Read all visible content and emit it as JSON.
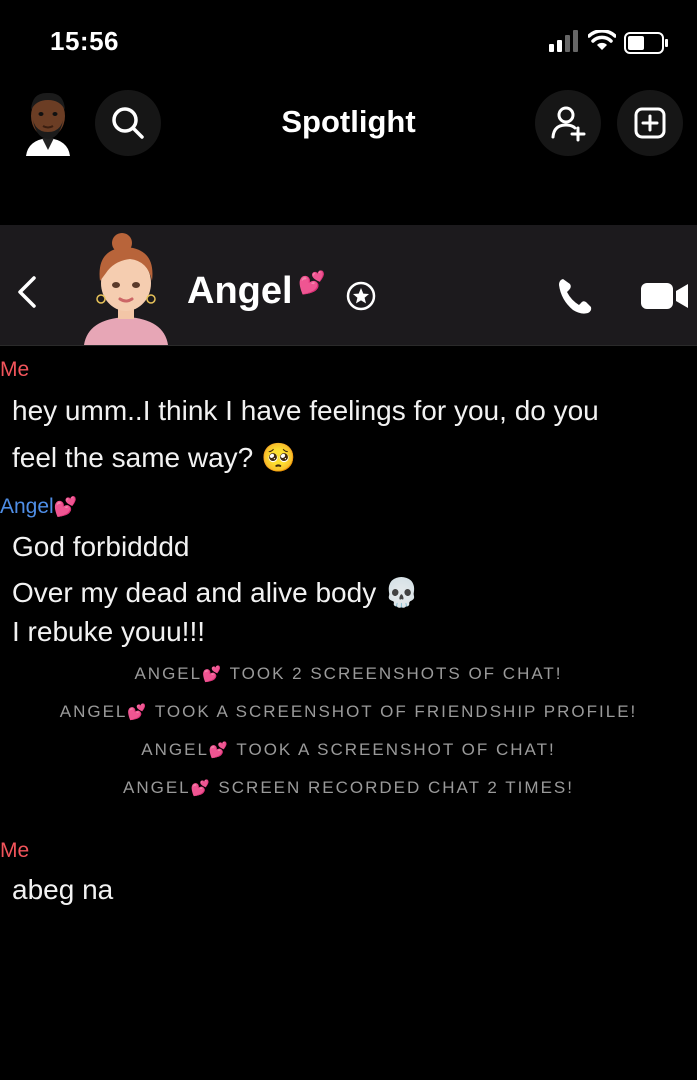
{
  "status": {
    "time": "15:56"
  },
  "top_bar": {
    "title": "Spotlight"
  },
  "chat_header": {
    "name": "Angel",
    "name_emoji": "💕"
  },
  "messages": [
    {
      "sender": "Me",
      "lines": [
        "hey umm..I think I have feelings for you, do you",
        "feel the same way? 🥺"
      ]
    },
    {
      "sender": "Angel",
      "sender_emoji": "💕",
      "lines": [
        "God forbidddd",
        "Over my dead and alive body 💀",
        "I rebuke youu!!!"
      ]
    },
    {
      "sender": "Me",
      "lines": [
        "abeg na"
      ]
    }
  ],
  "system_notices": [
    {
      "name": "ANGEL",
      "emoji": "💕",
      "text": "TOOK 2 SCREENSHOTS OF CHAT!"
    },
    {
      "name": "ANGEL",
      "emoji": "💕",
      "text": "TOOK A SCREENSHOT OF FRIENDSHIP PROFILE!"
    },
    {
      "name": "ANGEL",
      "emoji": "💕",
      "text": "TOOK A SCREENSHOT OF CHAT!"
    },
    {
      "name": "ANGEL",
      "emoji": "💕",
      "text": "SCREEN RECORDED CHAT 2 TIMES!"
    }
  ],
  "colors": {
    "background": "#000000",
    "header_bg": "#1c1a1d",
    "me_label": "#f2545b",
    "friend_label": "#4f8ee6",
    "notice_text": "#9a9a9a"
  },
  "icons": [
    "bitmoji-avatar-me",
    "search-icon",
    "add-friend-icon",
    "new-chat-icon",
    "back-icon",
    "bitmoji-avatar-angel",
    "star-badge-icon",
    "phone-icon",
    "video-icon"
  ]
}
